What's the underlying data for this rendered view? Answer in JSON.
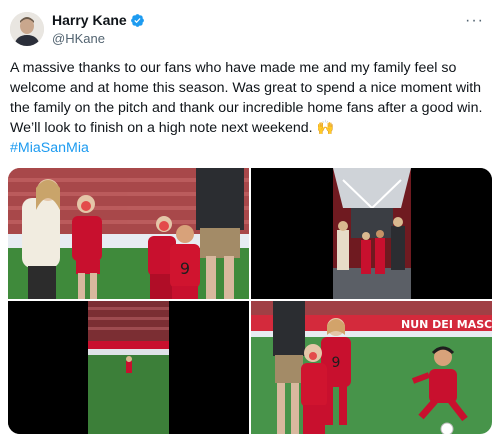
{
  "author": {
    "display_name": "Harry Kane",
    "handle": "@HKane",
    "verified_icon": "verified-badge-icon",
    "verified_color": "#1d9bf0"
  },
  "more_icon": "more-options-icon",
  "tweet": {
    "text": "A massive thanks to our fans who have made me and my family feel so welcome and at home this season. Was great to spend a nice moment with the family on the pitch and thank our incredible home fans after a good win. We’ll look to finish on a high note next weekend. 🙌",
    "hashtag": "#MiaSanMia"
  },
  "media": {
    "photo4_banner": "NUN DEI MASCH"
  },
  "colors": {
    "link": "#1d9bf0",
    "secondary_text": "#536471",
    "kit_red": "#c8102e"
  }
}
